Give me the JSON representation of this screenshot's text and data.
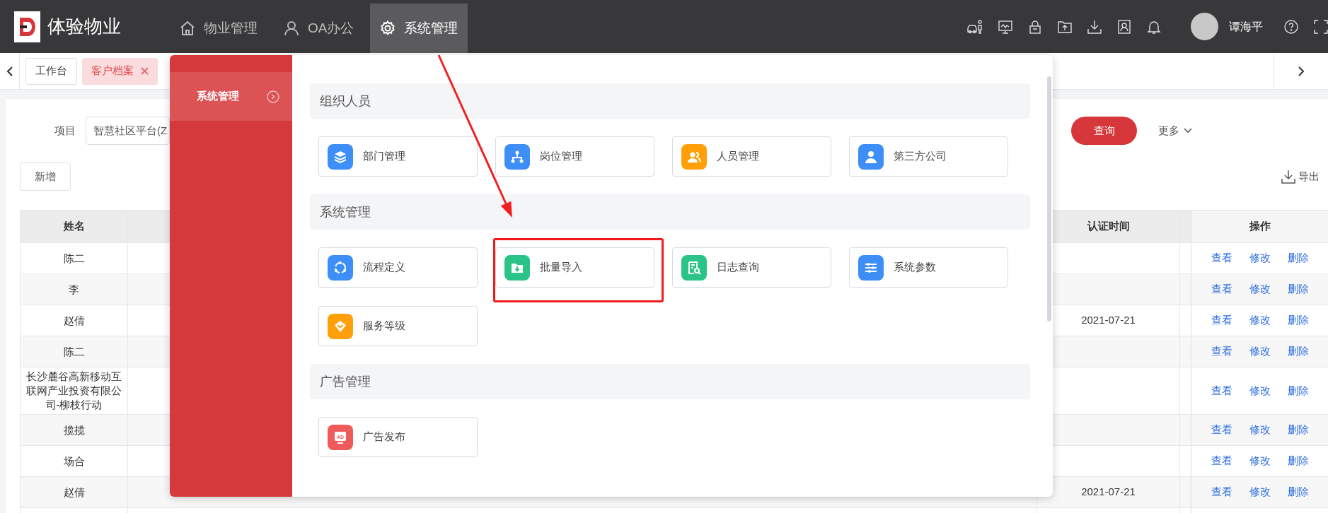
{
  "app": {
    "title": "体验物业"
  },
  "nav": [
    {
      "label": "物业管理",
      "selected": false
    },
    {
      "label": "OA办公",
      "selected": false
    },
    {
      "label": "系统管理",
      "selected": true
    }
  ],
  "user": {
    "name": "谭海平"
  },
  "tabs": [
    {
      "label": "工作台",
      "selected": false,
      "closable": false
    },
    {
      "label": "客户档案",
      "selected": true,
      "closable": true
    }
  ],
  "filter": {
    "label": "项目",
    "value": "智慧社区平台(Z",
    "query_button": "查询",
    "more": "更多"
  },
  "toolbar": {
    "add_button": "新增",
    "export": "导出"
  },
  "table": {
    "columns": [
      "姓名",
      "认证时间",
      "操作"
    ],
    "rows": [
      {
        "name": "陈二",
        "actions": [
          "查看",
          "修改",
          "删除"
        ]
      },
      {
        "name": "李",
        "actions": [
          "查看",
          "修改",
          "删除"
        ]
      },
      {
        "name": "赵倩",
        "auth_time": "2021-07-21",
        "actions": [
          "查看",
          "修改",
          "删除"
        ]
      },
      {
        "name": "陈二",
        "actions": [
          "查看",
          "修改",
          "删除"
        ]
      },
      {
        "name": "长沙麓谷高新移动互联网产业投资有限公司-柳枝行动",
        "actions": [
          "查看",
          "修改",
          "删除"
        ]
      },
      {
        "name": "揽揽",
        "actions": [
          "查看",
          "修改",
          "删除"
        ]
      },
      {
        "name": "场合",
        "actions": [
          "查看",
          "修改",
          "删除"
        ]
      },
      {
        "name": "赵倩",
        "auth_time": "2021-07-21",
        "actions": [
          "查看",
          "修改",
          "删除"
        ]
      }
    ]
  },
  "menu": {
    "sidebar": [
      {
        "label": "系统管理",
        "selected": true
      }
    ],
    "sections": [
      {
        "title": "组织人员",
        "items": [
          {
            "label": "部门管理",
            "highlighted": false
          },
          {
            "label": "岗位管理",
            "highlighted": false
          },
          {
            "label": "人员管理",
            "highlighted": false
          },
          {
            "label": "第三方公司",
            "highlighted": false
          }
        ]
      },
      {
        "title": "系统管理",
        "items": [
          {
            "label": "流程定义",
            "highlighted": false
          },
          {
            "label": "批量导入",
            "highlighted": true
          },
          {
            "label": "日志查询",
            "highlighted": false
          },
          {
            "label": "系统参数",
            "highlighted": false
          },
          {
            "label": "服务等级",
            "highlighted": false
          }
        ]
      },
      {
        "title": "广告管理",
        "items": [
          {
            "label": "广告发布",
            "highlighted": false,
            "icon_text": "AD"
          }
        ]
      }
    ]
  }
}
